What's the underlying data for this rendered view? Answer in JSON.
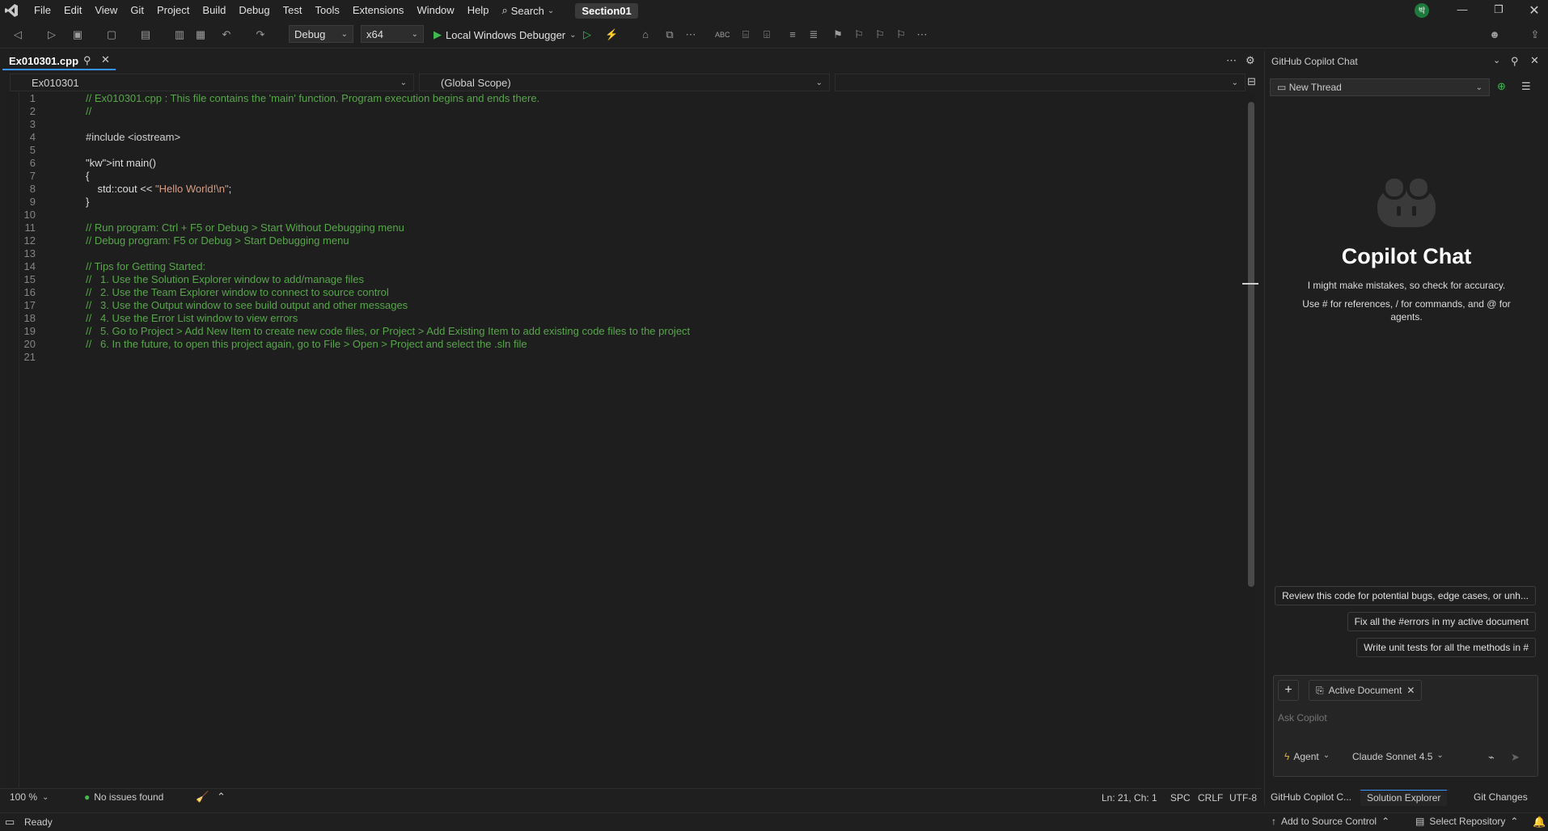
{
  "menu": [
    "File",
    "Edit",
    "View",
    "Git",
    "Project",
    "Build",
    "Debug",
    "Test",
    "Tools",
    "Extensions",
    "Window",
    "Help"
  ],
  "search_label": "Search",
  "solution_name": "Section01",
  "toolbar": {
    "config": "Debug",
    "platform": "x64",
    "debugger": "Local Windows Debugger"
  },
  "tab": {
    "file": "Ex010301.cpp"
  },
  "nav": {
    "project": "Ex010301",
    "scope": "(Global Scope)"
  },
  "code": [
    {
      "n": "1",
      "t": "// Ex010301.cpp : This file contains the 'main' function. Program execution begins and ends there."
    },
    {
      "n": "2",
      "t": "//"
    },
    {
      "n": "3",
      "t": ""
    },
    {
      "n": "4",
      "t": "#include <iostream>"
    },
    {
      "n": "5",
      "t": ""
    },
    {
      "n": "6",
      "t": "int main()"
    },
    {
      "n": "7",
      "t": "{"
    },
    {
      "n": "8",
      "t": "    std::cout << \"Hello World!\\n\";"
    },
    {
      "n": "9",
      "t": "}"
    },
    {
      "n": "10",
      "t": ""
    },
    {
      "n": "11",
      "t": "// Run program: Ctrl + F5 or Debug > Start Without Debugging menu"
    },
    {
      "n": "12",
      "t": "// Debug program: F5 or Debug > Start Debugging menu"
    },
    {
      "n": "13",
      "t": ""
    },
    {
      "n": "14",
      "t": "// Tips for Getting Started:"
    },
    {
      "n": "15",
      "t": "//   1. Use the Solution Explorer window to add/manage files"
    },
    {
      "n": "16",
      "t": "//   2. Use the Team Explorer window to connect to source control"
    },
    {
      "n": "17",
      "t": "//   3. Use the Output window to see build output and other messages"
    },
    {
      "n": "18",
      "t": "//   4. Use the Error List window to view errors"
    },
    {
      "n": "19",
      "t": "//   5. Go to Project > Add New Item to create new code files, or Project > Add Existing Item to add existing code files to the project"
    },
    {
      "n": "20",
      "t": "//   6. In the future, to open this project again, go to File > Open > Project and select the .sln file"
    },
    {
      "n": "21",
      "t": ""
    }
  ],
  "editor_status": {
    "zoom": "100 %",
    "issues": "No issues found",
    "pos": "Ln: 21, Ch: 1",
    "spc": "SPC",
    "crlf": "CRLF",
    "enc": "UTF-8"
  },
  "copilot": {
    "header": "GitHub Copilot Chat",
    "thread": "New Thread",
    "title": "Copilot Chat",
    "sub1": "I might make mistakes, so check for accuracy.",
    "sub2": "Use # for references, / for commands, and @ for agents.",
    "suggestions": [
      "Review this code for potential bugs, edge cases, or unh...",
      "Fix all the #errors in my active document",
      "Write unit tests for all the methods in #"
    ],
    "chip": "Active Document",
    "placeholder": "Ask Copilot",
    "mode": "Agent",
    "model": "Claude Sonnet 4.5"
  },
  "pane_tabs": [
    "GitHub Copilot C...",
    "Solution Explorer",
    "Git Changes"
  ],
  "status": {
    "ready": "Ready",
    "source": "Add to Source Control",
    "repo": "Select Repository"
  },
  "colors": {
    "accent": "#3794ff",
    "comment": "#57a64a",
    "keyword": "#569cd6",
    "string": "#d69d85",
    "run": "#3fb950"
  }
}
